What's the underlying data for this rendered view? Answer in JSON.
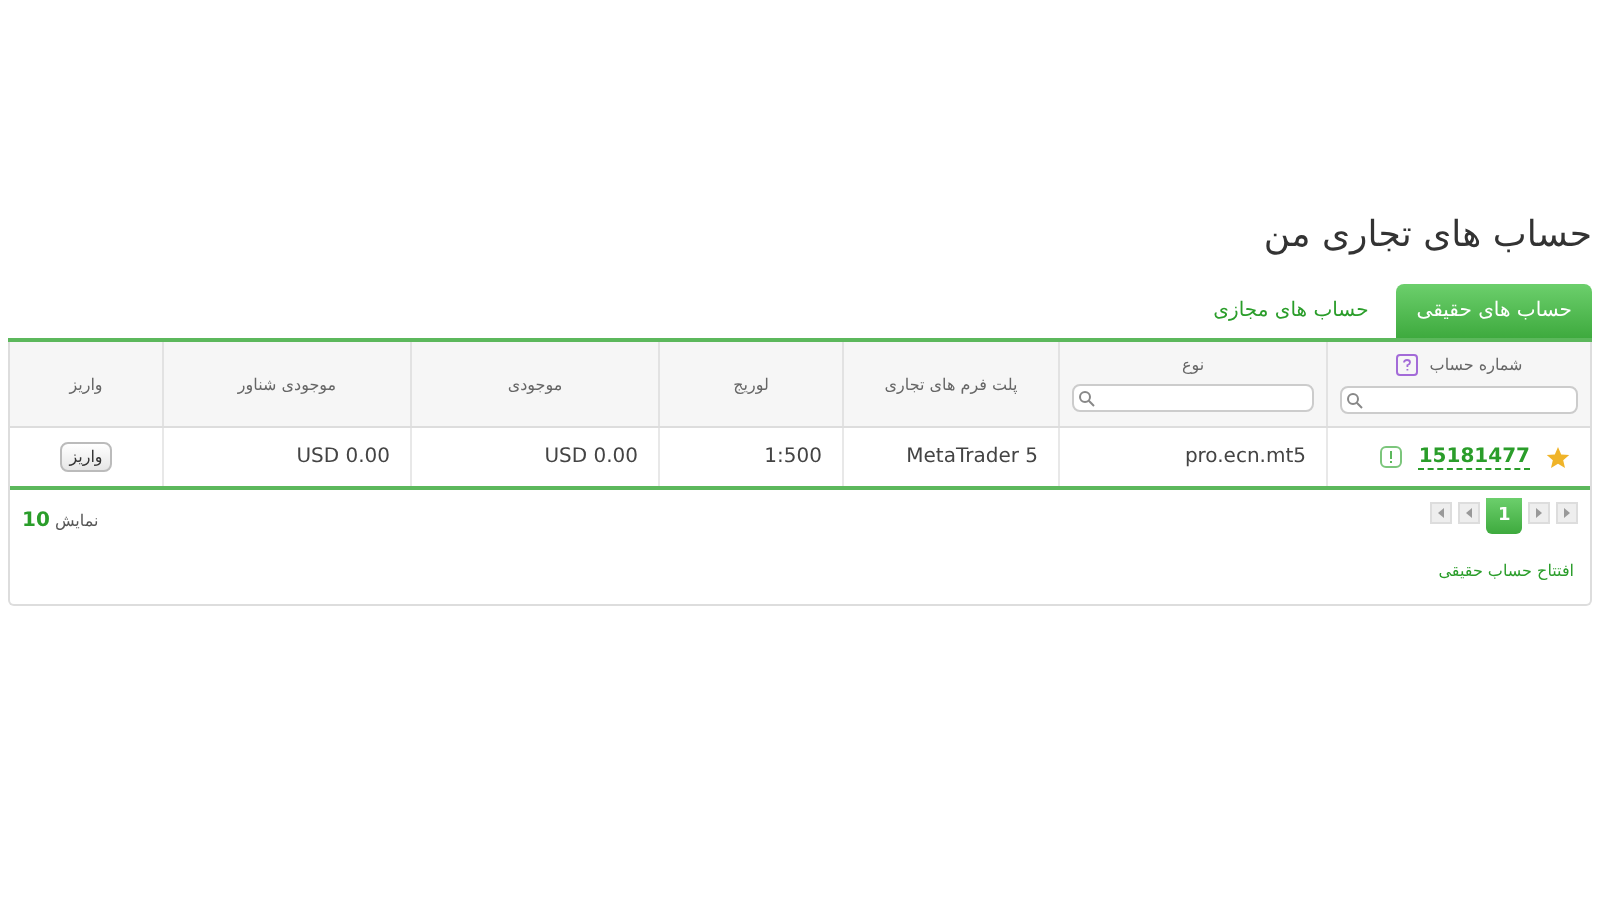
{
  "title": "حساب های تجاری من",
  "tabs": [
    {
      "label": "حساب های حقیقی",
      "selected": true
    },
    {
      "label": "حساب های مجازی",
      "selected": false
    }
  ],
  "table": {
    "columns": [
      {
        "label": "شماره حساب",
        "help": true,
        "filter": true
      },
      {
        "label": "نوع",
        "help": false,
        "filter": true
      },
      {
        "label": "پلت فرم های تجاری",
        "help": false,
        "filter": false
      },
      {
        "label": "لوریج",
        "help": false,
        "filter": false
      },
      {
        "label": "موجودی",
        "help": false,
        "filter": false
      },
      {
        "label": "موجودی شناور",
        "help": false,
        "filter": false
      },
      {
        "label": "واریز",
        "help": false,
        "filter": false
      }
    ],
    "rows": [
      {
        "starred": true,
        "account": "15181477",
        "type": "pro.ecn.mt5",
        "platform": "MetaTrader 5",
        "leverage": "1:500",
        "balance": "USD 0.00",
        "equity": "USD 0.00",
        "deposit_button": "واریز"
      }
    ]
  },
  "page_size": "نمایش **10**",
  "pages": [
    {
      "label": "1",
      "selected": true
    }
  ],
  "open_account_link": "افتتاح حساب حقیقی"
}
